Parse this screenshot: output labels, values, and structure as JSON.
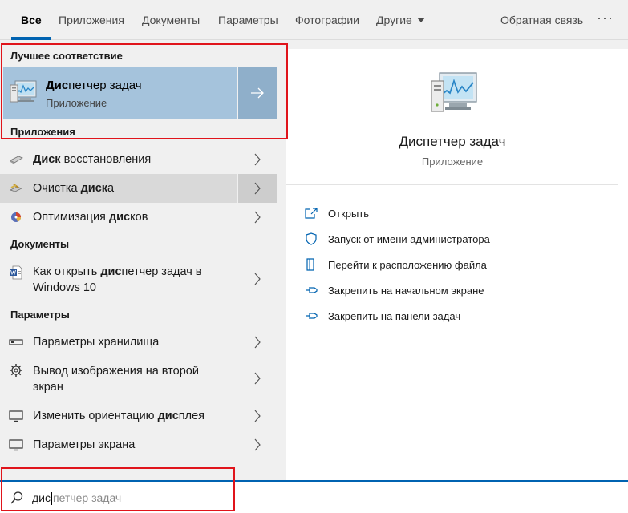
{
  "tabs": [
    {
      "label": "Все",
      "active": true
    },
    {
      "label": "Приложения"
    },
    {
      "label": "Документы"
    },
    {
      "label": "Параметры"
    },
    {
      "label": "Фотографии"
    },
    {
      "label": "Другие"
    }
  ],
  "header": {
    "feedback": "Обратная связь",
    "more": "···"
  },
  "best_match": {
    "section": "Лучшее соответствие",
    "title_bold": "Дис",
    "title_rest": "петчер задач",
    "subtitle": "Приложение"
  },
  "apps": {
    "section": "Приложения",
    "items": [
      {
        "bold": "Диск",
        "rest": " восстановления"
      },
      {
        "pre": "Очистка ",
        "bold": "диск",
        "rest": "а"
      },
      {
        "pre": "Оптимизация ",
        "bold": "дис",
        "rest": "ков"
      }
    ]
  },
  "documents": {
    "section": "Документы",
    "items": [
      {
        "line1_pre": "Как открыть ",
        "line1_bold": "дис",
        "line1_rest": "петчер задач в",
        "line2": "Windows 10"
      }
    ]
  },
  "settings": {
    "section": "Параметры",
    "items": [
      {
        "label": "Параметры хранилища"
      },
      {
        "line1": "Вывод изображения на второй",
        "line2": "экран"
      },
      {
        "pre": "Изменить ориентацию ",
        "bold": "дис",
        "rest": "плея"
      },
      {
        "label": "Параметры экрана"
      }
    ]
  },
  "preview": {
    "title": "Диспетчер задач",
    "subtitle": "Приложение",
    "actions": [
      {
        "label": "Открыть",
        "icon": "open-icon"
      },
      {
        "label": "Запуск от имени администратора",
        "icon": "shield-icon"
      },
      {
        "label": "Перейти к расположению файла",
        "icon": "file-location-icon"
      },
      {
        "label": "Закрепить на начальном экране",
        "icon": "pin-icon"
      },
      {
        "label": "Закрепить на панели задач",
        "icon": "pin-icon"
      }
    ]
  },
  "search": {
    "typed": "дис",
    "suggestion": "петчер задач"
  },
  "colors": {
    "accent": "#0063b1",
    "selection": "#a5c3dc",
    "highlight": "#d9d9d9",
    "annotation": "#e0141b"
  }
}
